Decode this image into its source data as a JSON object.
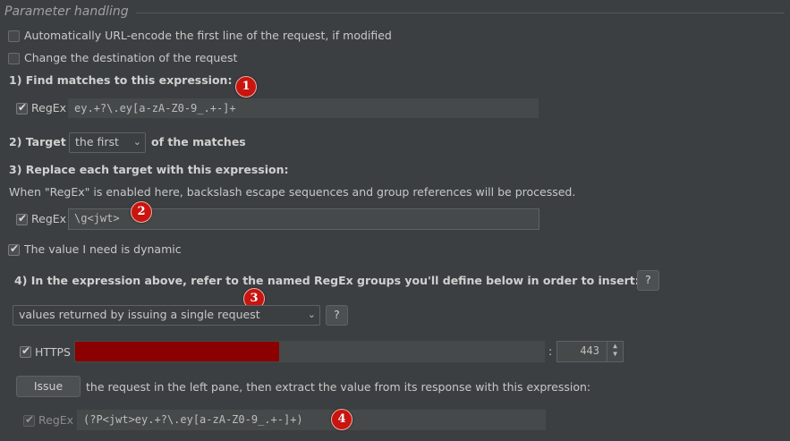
{
  "section_title": "Parameter handling",
  "options": {
    "url_encode": {
      "label": "Automatically URL-encode the first line of the request, if modified",
      "checked": false
    },
    "change_dest": {
      "label": "Change the destination of the request",
      "checked": false
    }
  },
  "step1": {
    "heading": "1) Find matches to this expression:",
    "regex_label": "RegEx",
    "regex_checked": true,
    "value": "ey.+?\\.ey[a-zA-Z0-9_.+-]+",
    "badge": "1"
  },
  "step2": {
    "prefix": "2) Target",
    "select_value": "the first",
    "suffix": "of the matches"
  },
  "step3": {
    "heading": "3) Replace each target with this expression:",
    "note": "When \"RegEx\" is enabled here, backslash escape sequences and group references will be processed.",
    "regex_label": "RegEx",
    "regex_checked": true,
    "value": "\\g<jwt>",
    "badge": "2",
    "dynamic_label": "The value I need is dynamic",
    "dynamic_checked": true
  },
  "step4": {
    "heading": "4) In the expression above, refer to the named RegEx groups you'll define below in order to insert:",
    "help": "?",
    "source_value": "values returned by issuing a single request",
    "source_help": "?",
    "badge": "3",
    "https_label": "HTTPS",
    "https_checked": true,
    "host_redacted": true,
    "colon": ":",
    "port": "443",
    "issue_button": "Issue",
    "issue_text": "the request in the left pane, then extract the value from its response with this expression:",
    "extract_label": "RegEx",
    "extract_checked": true,
    "extract_value": "(?P<jwt>ey.+?\\.ey[a-zA-Z0-9_.+-]+)",
    "badge4": "4"
  },
  "colors": {
    "background": "#3c3f41",
    "field": "#45494a",
    "badge_red": "#c8150f",
    "redaction": "#8b0000"
  }
}
